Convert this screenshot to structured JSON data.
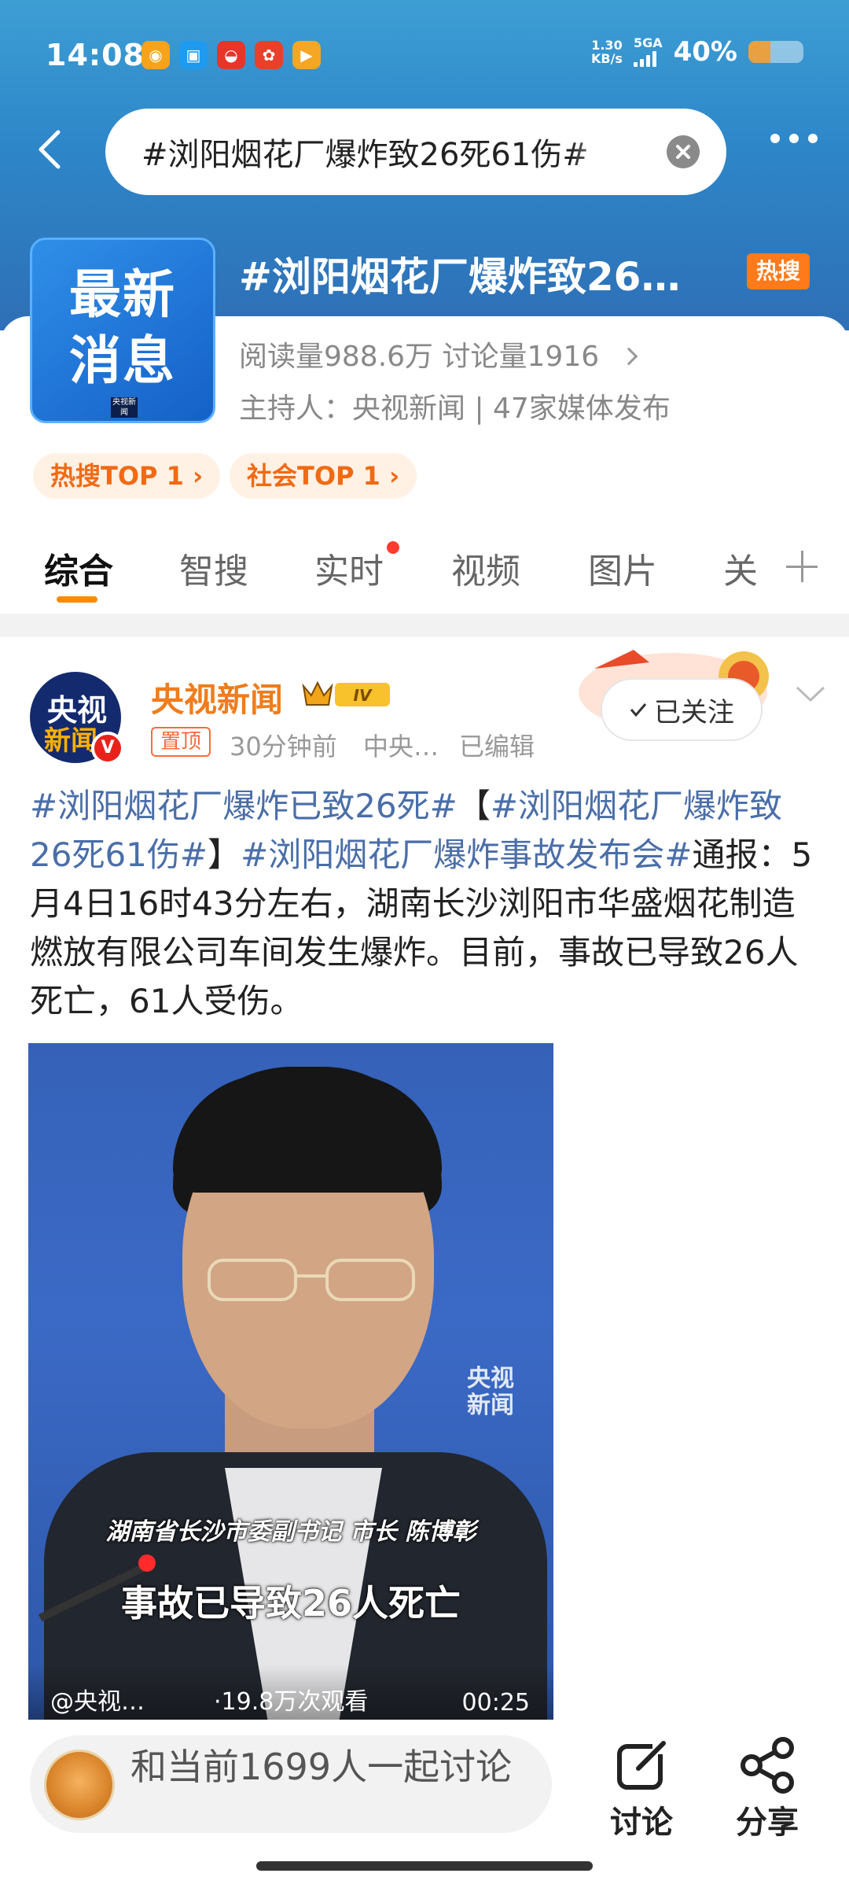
{
  "status_bar": {
    "time": "14:08",
    "net_speed_value": "1.30",
    "net_speed_unit": "KB/s",
    "network": "5GA",
    "battery_percent": "40%",
    "battery_level": 0.4
  },
  "search": {
    "query": "#浏阳烟花厂爆炸致26死61伤#"
  },
  "topic": {
    "title": "#浏阳烟花厂爆炸致26…",
    "hot_badge": "热搜",
    "cover_line1": "最新",
    "cover_line2": "消息",
    "cover_mark": "央视新闻",
    "stats": "阅读量988.6万  讨论量1916",
    "host": "主持人：央视新闻 | 47家媒体发布",
    "tags": [
      "热搜TOP 1",
      "社会TOP 1"
    ]
  },
  "tabs": [
    "综合",
    "智搜",
    "实时",
    "视频",
    "图片",
    "关"
  ],
  "post": {
    "avatar_line1": "央视",
    "avatar_line2": "新闻",
    "verify": "V",
    "author": "央视新闻",
    "member_badge": "IV",
    "pin_label": "置顶",
    "time": "30分钟前",
    "source": "中央…",
    "edited": "已编辑",
    "follow_label": "已关注",
    "text_tag1": "#浏阳烟花厂爆炸已致26死#",
    "text_bracket_open": "【",
    "text_tag2": "#浏阳烟花厂爆炸致26死61伤#",
    "text_bracket_close": "】",
    "text_tag3": "#浏阳烟花厂爆炸事故发布会#",
    "text_body": "通报：5月4日16时43分左右，湖南长沙浏阳市华盛烟花制造燃放有限公司车间发生爆炸。目前，事故已导致26人死亡，61人受伤。"
  },
  "video": {
    "watermark": "央视新闻",
    "caption_speaker": "湖南省长沙市委副书记 市长 陈博彰",
    "caption_main": "事故已导致26人死亡",
    "source": "@央视…",
    "views": "·19.8万次观看",
    "duration": "00:25"
  },
  "bottom_bar": {
    "discuss_prompt": "和当前1699人一起讨论",
    "discuss_label": "讨论",
    "share_label": "分享"
  },
  "colors": {
    "header_blue": "#2d86c8",
    "accent_orange": "#f07c1b",
    "hashtag_blue": "#4a6ea8",
    "hot_red": "#ff3b30"
  }
}
